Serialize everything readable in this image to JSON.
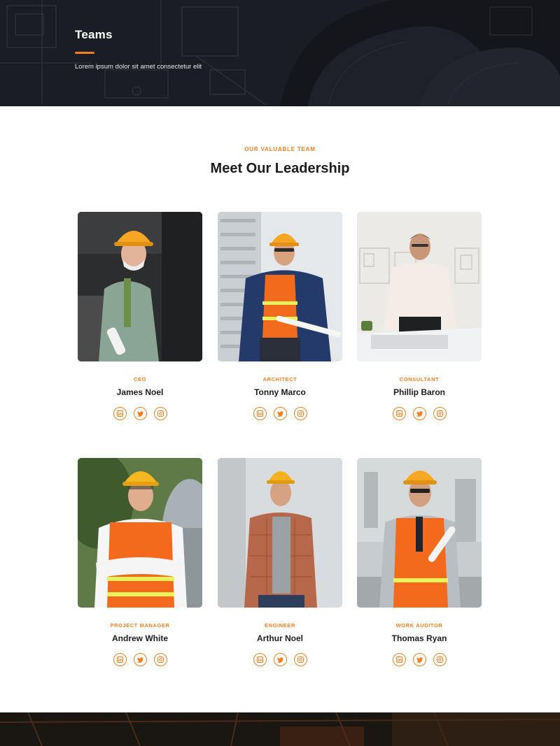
{
  "hero": {
    "title": "Teams",
    "subtitle": "Lorem ipsum dolor sit amet consectetur elit"
  },
  "section": {
    "eyebrow": "OUR VALUABLE TEAM",
    "heading": "Meet Our Leadership"
  },
  "colors": {
    "accent": "#f47f20",
    "dark": "#1b1d24",
    "text": "#1c1d22"
  },
  "team": [
    {
      "role": "CEO",
      "name": "James Noel",
      "social": [
        "linkedin-icon",
        "twitter-icon",
        "instagram-icon"
      ]
    },
    {
      "role": "ARCHITECT",
      "name": "Tonny Marco",
      "social": [
        "linkedin-icon",
        "twitter-icon",
        "instagram-icon"
      ]
    },
    {
      "role": "CONSULTANT",
      "name": "Phillip Baron",
      "social": [
        "linkedin-icon",
        "twitter-icon",
        "instagram-icon"
      ]
    },
    {
      "role": "PROJECT MANAGER",
      "name": "Andrew White",
      "social": [
        "linkedin-icon",
        "twitter-icon",
        "instagram-icon"
      ]
    },
    {
      "role": "ENGINEER",
      "name": "Arthur Noel",
      "social": [
        "linkedin-icon",
        "twitter-icon",
        "instagram-icon"
      ]
    },
    {
      "role": "WORK AUDITOR",
      "name": "Thomas Ryan",
      "social": [
        "linkedin-icon",
        "twitter-icon",
        "instagram-icon"
      ]
    }
  ]
}
